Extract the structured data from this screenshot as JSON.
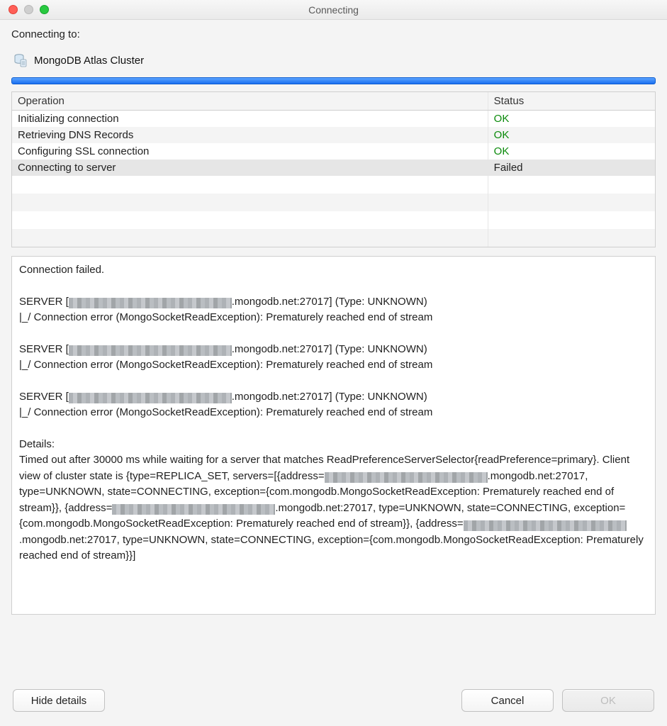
{
  "window": {
    "title": "Connecting"
  },
  "header": {
    "connecting_to_label": "Connecting to:",
    "target_name": "MongoDB Atlas Cluster"
  },
  "table": {
    "columns": {
      "operation": "Operation",
      "status": "Status"
    },
    "rows": [
      {
        "op": "Initializing connection",
        "status": "OK",
        "ok": true
      },
      {
        "op": "Retrieving DNS Records",
        "status": "OK",
        "ok": true
      },
      {
        "op": "Configuring SSL connection",
        "status": "OK",
        "ok": true
      },
      {
        "op": "Connecting to server",
        "status": "Failed",
        "ok": false
      }
    ]
  },
  "details": {
    "title": "Connection failed.",
    "server_suffix": ".mongodb.net:27017] (Type: UNKNOWN)",
    "server_prefix": "SERVER [",
    "error_line": "|_/ Connection error (MongoSocketReadException): Prematurely reached end of stream",
    "details_label": "Details:",
    "details_body_pre": "Timed out after 30000 ms while waiting for a server that matches ReadPreferenceServerSelector{readPreference=primary}. Client view of cluster state is {type=REPLICA_SET, servers=[{address=",
    "addr_suffix": ".mongodb.net:27017, type=UNKNOWN, state=CONNECTING, exception={com.mongodb.MongoSocketReadException: Prematurely reached end of stream}}, {address=",
    "addr_suffix_last": ".mongodb.net:27017, type=UNKNOWN, state=CONNECTING, exception={com.mongodb.MongoSocketReadException: Prematurely reached end of stream}}]"
  },
  "footer": {
    "hide_details": "Hide details",
    "cancel": "Cancel",
    "ok": "OK"
  }
}
